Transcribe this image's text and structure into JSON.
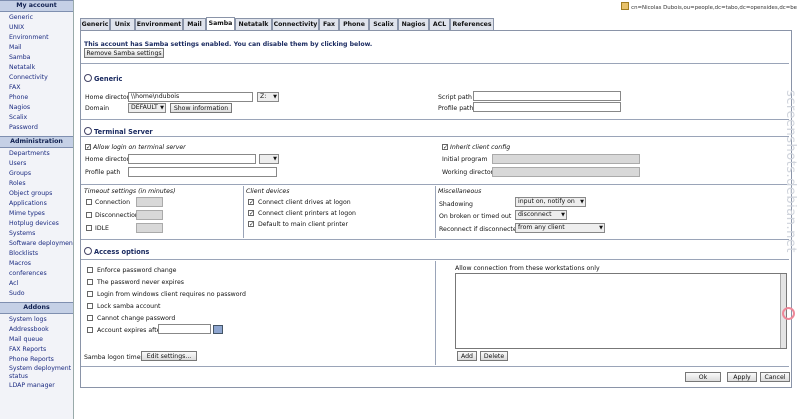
{
  "user_dn": "cn=Nicolas Dubois,ou=people,dc=tabo,dc=opensides,dc=be",
  "sidebar": {
    "sections": [
      {
        "title": "My account",
        "items": [
          "Generic",
          "UNIX",
          "Environment",
          "Mail",
          "Samba",
          "Netatalk",
          "Connectivity",
          "FAX",
          "Phone",
          "Nagios",
          "Scalix",
          "Password"
        ]
      },
      {
        "title": "Administration",
        "items": [
          "Departments",
          "Users",
          "Groups",
          "Roles",
          "Object groups",
          "Applications",
          "Mime types",
          "Hotplug devices",
          "Systems",
          "Software deployment",
          "Blocklists",
          "Macros",
          "conferences",
          "Acl",
          "Sudo"
        ]
      },
      {
        "title": "Addons",
        "items": [
          "System logs",
          "Addressbook",
          "Mail queue",
          "FAX Reports",
          "Phone Reports",
          "System deployment status",
          "LDAP manager"
        ]
      }
    ]
  },
  "tabs": [
    "Generic",
    "Unix",
    "Environment",
    "Mail",
    "Samba",
    "Netatalk",
    "Connectivity",
    "Fax",
    "Phone",
    "Scalix",
    "Nagios",
    "ACL",
    "References"
  ],
  "active_tab": "Samba",
  "status_text": "This account has Samba settings enabled. You can disable them by clicking below.",
  "remove_button": "Remove Samba settings",
  "generic": {
    "title": "Generic",
    "home_directory_label": "Home directory",
    "home_directory_value": "\\\\home\\ndubois",
    "drive_value": "Z:",
    "domain_label": "Domain",
    "domain_value": "DEFAULT",
    "show_info_button": "Show information",
    "script_path_label": "Script path",
    "profile_path_label": "Profile path"
  },
  "terminal": {
    "title": "Terminal Server",
    "allow_login_label": "Allow login on terminal server",
    "home_directory_label": "Home directory",
    "profile_path_label": "Profile path",
    "inherit_label": "Inherit client config",
    "initial_program_label": "Initial program",
    "working_directory_label": "Working directory",
    "timeout_title": "Timeout settings (in minutes)",
    "timeout_items": [
      "Connection",
      "Disconnection",
      "IDLE"
    ],
    "devices_title": "Client devices",
    "devices_items": [
      "Connect client drives at logon",
      "Connect client printers at logon",
      "Default to main client printer"
    ],
    "misc_title": "Miscellaneous",
    "shadowing_label": "Shadowing",
    "shadowing_value": "input on, notify on",
    "broken_label": "On broken or timed out",
    "broken_value": "disconnect",
    "reconnect_label": "Reconnect if disconnected",
    "reconnect_value": "from any client"
  },
  "access": {
    "title": "Access options",
    "options": [
      "Enforce password change",
      "The password never expires",
      "Login from windows client requires no password",
      "Lock samba account",
      "Cannot change password",
      "Account expires after"
    ],
    "workstations_label": "Allow connection from these workstations only",
    "add_button": "Add",
    "delete_button": "Delete",
    "logon_times_label": "Samba logon times",
    "edit_settings_button": "Edit settings..."
  },
  "footer": {
    "ok": "Ok",
    "apply": "Apply",
    "cancel": "Cancel"
  },
  "watermark": "screenshots.debian.net"
}
